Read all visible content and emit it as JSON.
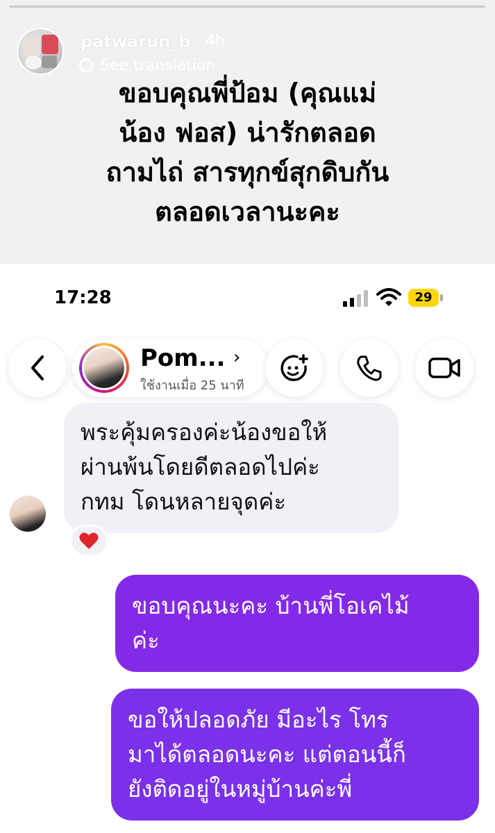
{
  "story": {
    "username": "patwarun_b",
    "time": "4h",
    "see_translation": "See translation",
    "caption": "ขอบคุณพี่ป้อม (คุณแม่\nน้อง ฟอส) น่ารักตลอด\nถามไถ่ สารทุกข์สุกดิบกัน\nตลอดเวลานะคะ"
  },
  "status_bar": {
    "time": "17:28",
    "battery": "29"
  },
  "chat": {
    "contact_name": "Pom...",
    "contact_status": "ใช้งานเมื่อ 25 นาที",
    "messages": [
      {
        "direction": "incoming",
        "text": "พระคุ้มครองค่ะน้องขอให้\nผ่านพ้นโดยดีตลอดไปค่ะ\nกทม โดนหลายจุดค่ะ",
        "reaction": "heart"
      },
      {
        "direction": "outgoing",
        "text": "ขอบคุณนะคะ บ้านพี่โอเคไม้\nค่ะ"
      },
      {
        "direction": "outgoing",
        "text": "ขอให้ปลอดภัย มีอะไร โทร\nมาได้ตลอดนะคะ แต่ตอนนี้ก็\nยังติดอยู่ในหมู่บ้านค่ะพี่"
      }
    ]
  },
  "icons": {
    "back": "chevron-left-icon",
    "effects": "sticker-plus-icon",
    "call": "phone-icon",
    "video": "video-camera-icon",
    "reaction": "heart-icon"
  },
  "colors": {
    "outgoing_bubble": "#8529e8",
    "incoming_bubble": "#eff1f6",
    "battery": "#ffd60a",
    "reaction_heart": "#e0242b"
  }
}
